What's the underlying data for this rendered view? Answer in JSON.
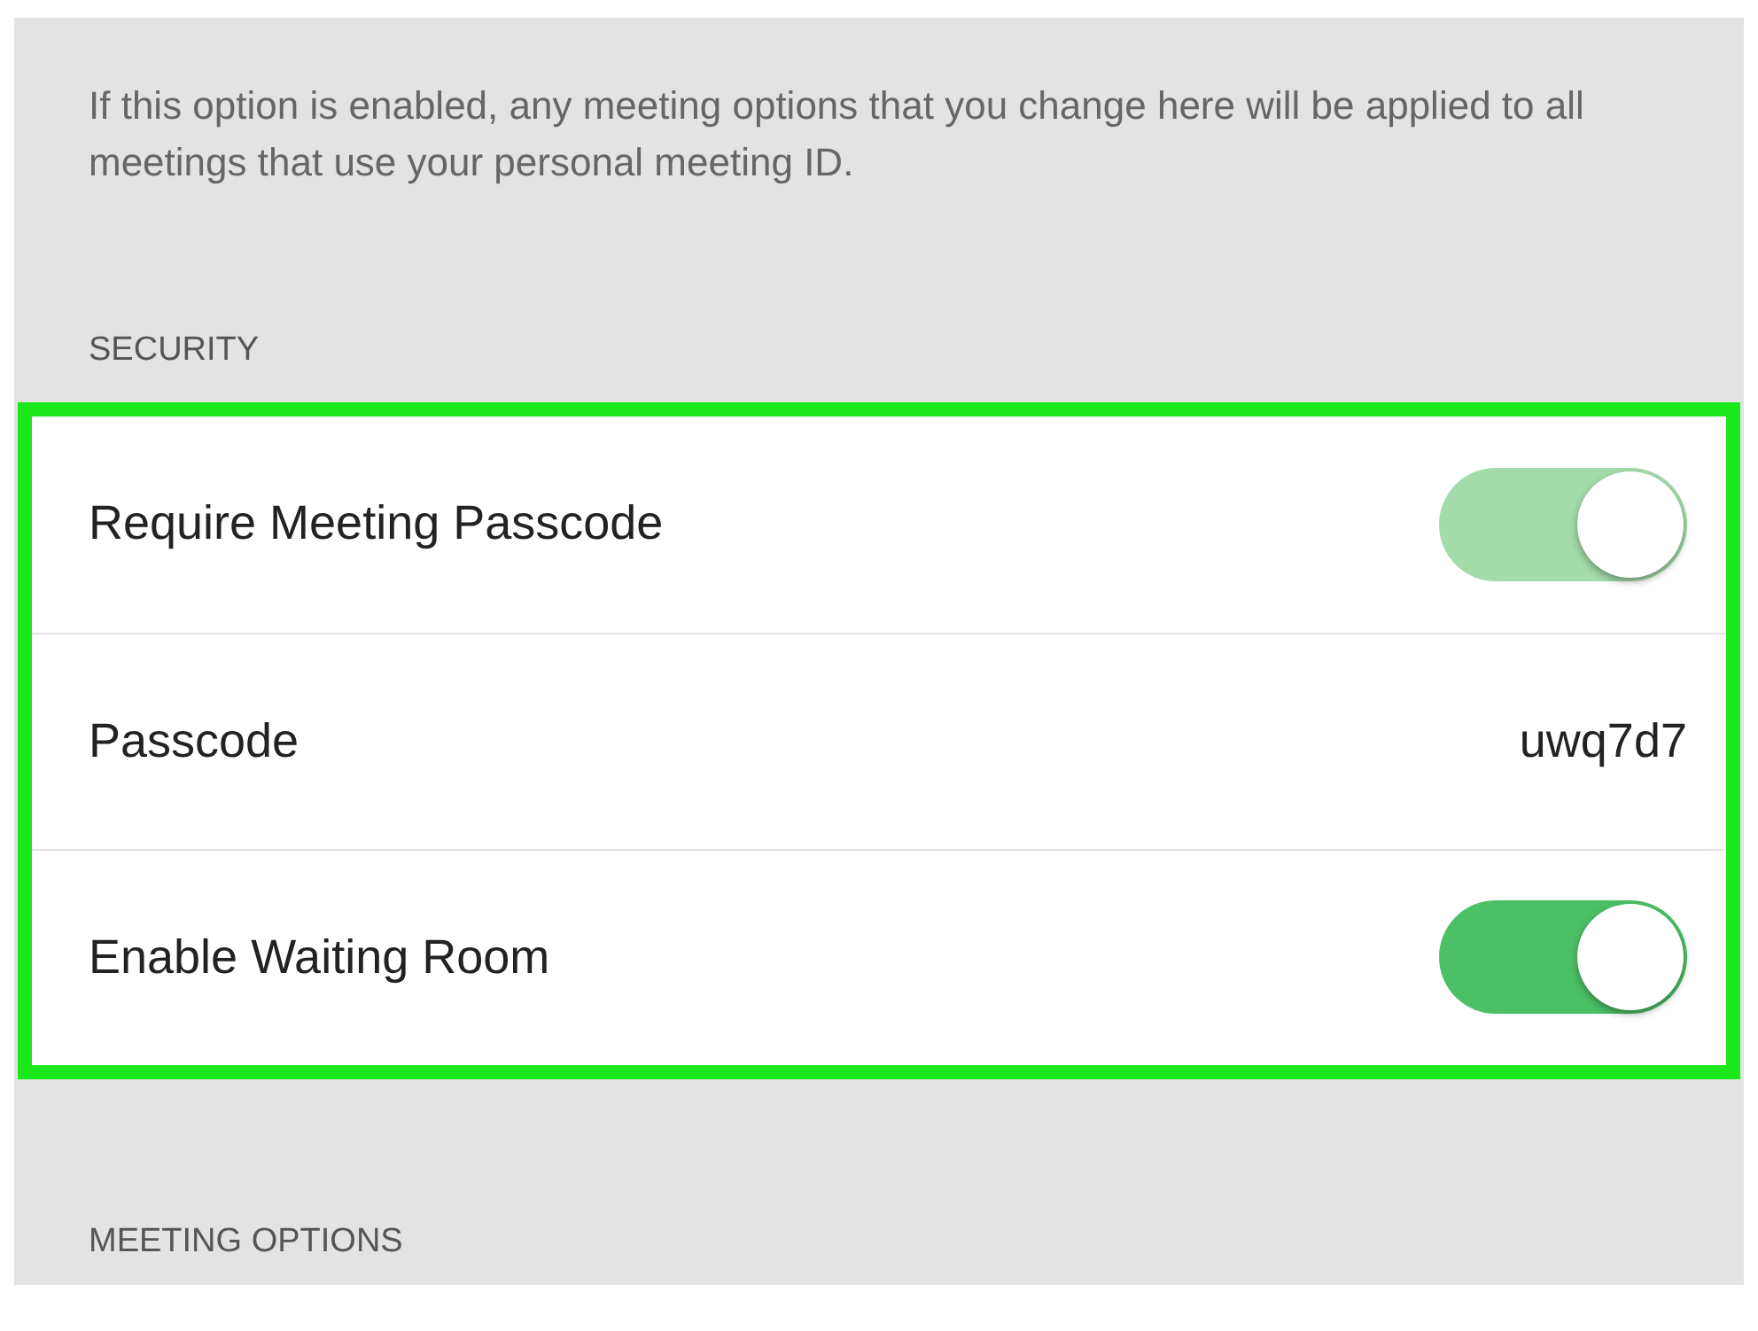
{
  "description": "If this option is enabled, any meeting options that you change here will be applied to all meetings that use your personal meeting ID.",
  "security": {
    "header": "SECURITY",
    "highlighted": true,
    "rows": [
      {
        "kind": "toggle",
        "label": "Require Meeting Passcode",
        "on": true,
        "disabled": true
      },
      {
        "kind": "value",
        "label": "Passcode",
        "value": "uwq7d7"
      },
      {
        "kind": "toggle",
        "label": "Enable Waiting Room",
        "on": true,
        "disabled": false
      }
    ]
  },
  "meeting_options": {
    "header": "MEETING OPTIONS"
  }
}
